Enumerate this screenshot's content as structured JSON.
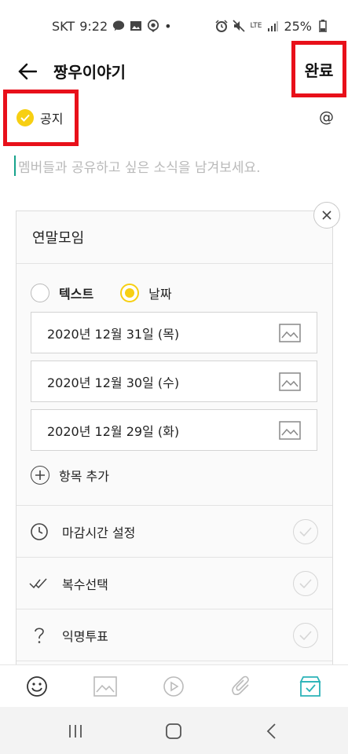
{
  "status_bar": {
    "carrier": "SKT",
    "time": "9:22",
    "dot": "•",
    "network": "LTE",
    "battery": "25%"
  },
  "header": {
    "title": "짱우이야기",
    "done_label": "완료"
  },
  "notice": {
    "label": "공지",
    "mention_symbol": "@"
  },
  "editor": {
    "placeholder": "멤버들과 공유하고 싶은 소식을 남겨보세요."
  },
  "poll": {
    "title": "연말모임",
    "types": [
      {
        "label": "텍스트",
        "selected": false
      },
      {
        "label": "날짜",
        "selected": true
      }
    ],
    "options": [
      {
        "text": "2020년 12월 31일 (목)"
      },
      {
        "text": "2020년 12월 30일 (수)"
      },
      {
        "text": "2020년 12월 29일 (화)"
      }
    ],
    "add_item_label": "항목 추가",
    "settings": [
      {
        "label": "마감시간 설정",
        "icon": "clock-icon"
      },
      {
        "label": "복수선택",
        "icon": "double-check-icon"
      },
      {
        "label": "익명투표",
        "icon": "question-icon"
      }
    ]
  },
  "toolbar": {
    "items": [
      "emoji-icon",
      "image-icon",
      "video-icon",
      "attach-icon",
      "poll-box-icon"
    ],
    "active_color": "#2bb3b8"
  },
  "colors": {
    "accent_yellow": "#f7cf12",
    "highlight_red": "#e8101a",
    "caret_teal": "#17a38c"
  }
}
